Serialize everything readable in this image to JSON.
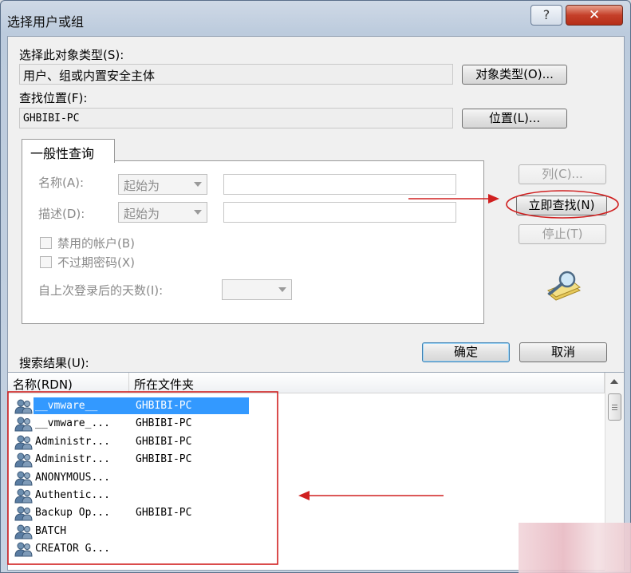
{
  "window": {
    "title": "选择用户或组",
    "help_label": "?",
    "close_label": "✕"
  },
  "object_types": {
    "label": "选择此对象类型(S):",
    "value": "用户、组或内置安全主体",
    "button": "对象类型(O)..."
  },
  "location": {
    "label": "查找位置(F):",
    "value": "GHBIBI-PC",
    "button": "位置(L)..."
  },
  "common_query": {
    "tab_label": "一般性查询",
    "name_label": "名称(A):",
    "name_mode": "起始为",
    "desc_label": "描述(D):",
    "desc_mode": "起始为",
    "disabled_accounts": "禁用的帐户(B)",
    "non_expiring_pw": "不过期密码(X)",
    "days_since_login": "自上次登录后的天数(I):"
  },
  "side_buttons": {
    "columns": "列(C)...",
    "find_now": "立即查找(N)",
    "stop": "停止(T)"
  },
  "dialog_buttons": {
    "ok": "确定",
    "cancel": "取消"
  },
  "results": {
    "label": "搜索结果(U):",
    "columns": [
      "名称(RDN)",
      "所在文件夹"
    ],
    "rows": [
      {
        "name": "__vmware__",
        "folder": "GHBIBI-PC",
        "selected": true
      },
      {
        "name": "__vmware_...",
        "folder": "GHBIBI-PC",
        "selected": false
      },
      {
        "name": "Administr...",
        "folder": "GHBIBI-PC",
        "selected": false
      },
      {
        "name": "Administr...",
        "folder": "GHBIBI-PC",
        "selected": false
      },
      {
        "name": "ANONYMOUS...",
        "folder": "",
        "selected": false
      },
      {
        "name": "Authentic...",
        "folder": "",
        "selected": false
      },
      {
        "name": "Backup Op...",
        "folder": "GHBIBI-PC",
        "selected": false
      },
      {
        "name": "BATCH",
        "folder": "",
        "selected": false
      },
      {
        "name": "CREATOR G...",
        "folder": "",
        "selected": false
      }
    ]
  },
  "colors": {
    "annotation_red": "#d02020",
    "selection": "#3399ff"
  }
}
